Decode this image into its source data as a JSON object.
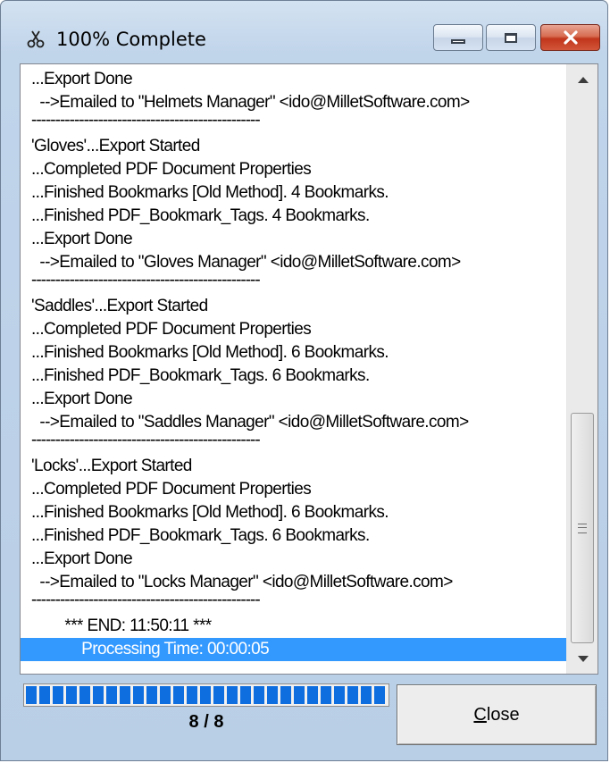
{
  "window": {
    "title": "100% Complete",
    "app_icon": "scissors-icon"
  },
  "caption_buttons": {
    "minimize": "minimize-icon",
    "maximize": "maximize-icon",
    "close": "close-icon"
  },
  "log": {
    "lines": [
      "...Export Done",
      "  -->Emailed to \"Helmets Manager\" <ido@MilletSoftware.com>",
      "------------------------------------------------",
      "'Gloves'...Export Started",
      "...Completed PDF Document Properties",
      "...Finished Bookmarks [Old Method]. 4 Bookmarks.",
      "...Finished PDF_Bookmark_Tags. 4 Bookmarks.",
      "...Export Done",
      "  -->Emailed to \"Gloves Manager\" <ido@MilletSoftware.com>",
      "------------------------------------------------",
      "'Saddles'...Export Started",
      "...Completed PDF Document Properties",
      "...Finished Bookmarks [Old Method]. 6 Bookmarks.",
      "...Finished PDF_Bookmark_Tags. 6 Bookmarks.",
      "...Export Done",
      "  -->Emailed to \"Saddles Manager\" <ido@MilletSoftware.com>",
      "------------------------------------------------",
      "'Locks'...Export Started",
      "...Completed PDF Document Properties",
      "...Finished Bookmarks [Old Method]. 6 Bookmarks.",
      "...Finished PDF_Bookmark_Tags. 6 Bookmarks.",
      "...Export Done",
      "  -->Emailed to \"Locks Manager\" <ido@MilletSoftware.com>",
      "------------------------------------------------",
      "        *** END: 11:50:11 ***",
      "            Processing Time: 00:00:05"
    ],
    "selected_index": 25
  },
  "progress": {
    "fraction": 1.0,
    "counter": "8 / 8"
  },
  "buttons": {
    "close_accel": "C",
    "close_rest": "lose"
  },
  "colors": {
    "selection": "#3399ff",
    "progress": "#0e6ee0",
    "close_caption": "#c1351b"
  }
}
